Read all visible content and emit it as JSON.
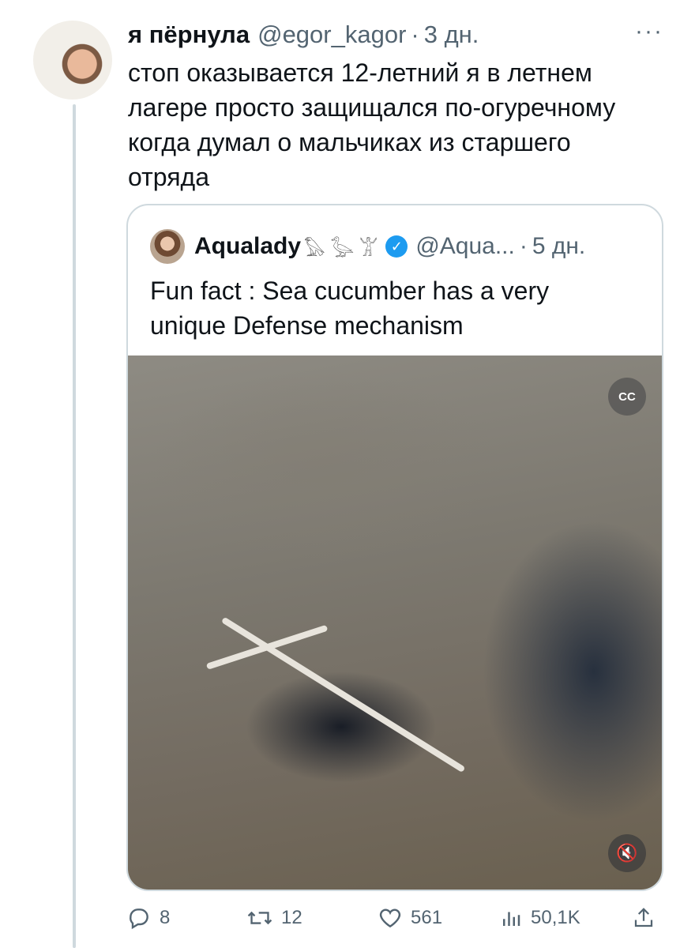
{
  "tweet": {
    "display_name": "я пёрнула",
    "handle": "@egor_kagor",
    "separator": "·",
    "time": "3 дн.",
    "more": "···",
    "text": "стоп оказывается 12-летний я в летнем\nлагере просто защищался по-огуречному\nкогда думал о мальчиках из старшего\nотряда"
  },
  "quote": {
    "display_name": "Aqualady",
    "name_emoji": "𓅃 𓅭 𓀠",
    "handle": "@Aqua...",
    "separator": "·",
    "time": "5 дн.",
    "text": "Fun fact : Sea cucumber has a very\nunique Defense mechanism",
    "cc_label": "CC",
    "mute_symbol": "🔇"
  },
  "actions": {
    "replies": "8",
    "retweets": "12",
    "likes": "561",
    "views": "50,1K"
  },
  "colors": {
    "text": "#0f1419",
    "secondary": "#536471",
    "border": "#cfd9de",
    "verified": "#1d9bf0"
  }
}
